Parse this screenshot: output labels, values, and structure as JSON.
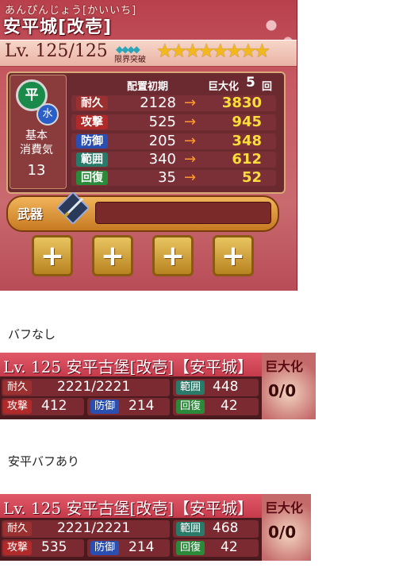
{
  "card": {
    "kana": "あんぴんじょう[かいいち]",
    "name": "安平城[改壱]",
    "level": "Lv. 125/125",
    "gems": "◆◆◆◆",
    "limit_break": "限界突破",
    "stars": "★★★★★★★★",
    "type": "平",
    "element": "水",
    "cost_label_1": "基本",
    "cost_label_2": "消費気",
    "cost_value": "13",
    "header_base": "配置初期",
    "header_max": "巨大化",
    "header_max_count": "5",
    "header_max_suffix": "回",
    "stats": [
      {
        "label": "耐久",
        "base": "2128",
        "arrow": "→",
        "max": "3830",
        "color": "#9a3030"
      },
      {
        "label": "攻撃",
        "base": "525",
        "arrow": "→",
        "max": "945",
        "color": "#b02a2a"
      },
      {
        "label": "防御",
        "base": "205",
        "arrow": "→",
        "max": "348",
        "color": "#2a4fb0"
      },
      {
        "label": "範囲",
        "base": "340",
        "arrow": "→",
        "max": "612",
        "color": "#2a7a6a"
      },
      {
        "label": "回復",
        "base": "35",
        "arrow": "→",
        "max": "52",
        "color": "#2a8a3a"
      }
    ],
    "weapon_label": "武器",
    "plus_buttons": [
      "+",
      "+",
      "+",
      "+"
    ]
  },
  "caption_no_buff": "バフなし",
  "caption_buff": "安平バフあり",
  "summary_no_buff": {
    "title": "Lv. 125 安平古堡[改壱]【安平城】",
    "kyodai": "巨大化",
    "count": "0/0",
    "hp_label": "耐久",
    "hp_value": "2221/2221",
    "range_label": "範囲",
    "range_value": "448",
    "atk_label": "攻撃",
    "atk_value": "412",
    "def_label": "防御",
    "def_value": "214",
    "rec_label": "回復",
    "rec_value": "42"
  },
  "summary_buff": {
    "title": "Lv. 125 安平古堡[改壱]【安平城】",
    "kyodai": "巨大化",
    "count": "0/0",
    "hp_label": "耐久",
    "hp_value": "2221/2221",
    "range_label": "範囲",
    "range_value": "468",
    "atk_label": "攻撃",
    "atk_value": "535",
    "def_label": "防御",
    "def_value": "214",
    "rec_label": "回復",
    "rec_value": "42"
  }
}
